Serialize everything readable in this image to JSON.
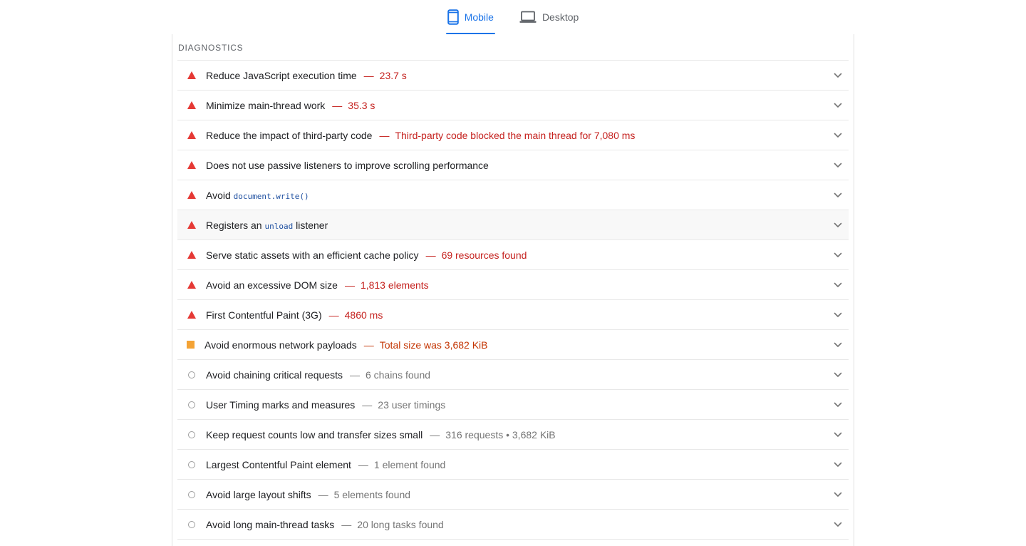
{
  "tabs": [
    {
      "label": "Mobile",
      "active": true,
      "icon": "phone-icon"
    },
    {
      "label": "Desktop",
      "active": false,
      "icon": "laptop-icon"
    }
  ],
  "colors": {
    "accent": "#1a73e8",
    "fail": "#e53935",
    "fail_text": "#c5221f",
    "average": "#f4a335",
    "average_text": "#c33300",
    "info_text": "#757575"
  },
  "diagnostics": {
    "title": "DIAGNOSTICS",
    "audits": [
      {
        "status": "fail",
        "title": "Reduce JavaScript execution time",
        "display": "23.7 s"
      },
      {
        "status": "fail",
        "title": "Minimize main-thread work",
        "display": "35.3 s"
      },
      {
        "status": "fail",
        "title": "Reduce the impact of third-party code",
        "display": "Third-party code blocked the main thread for 7,080 ms"
      },
      {
        "status": "fail",
        "title": "Does not use passive listeners to improve scrolling performance",
        "display": ""
      },
      {
        "status": "fail",
        "title_prefix": "Avoid ",
        "code": "document.write()",
        "title_suffix": "",
        "display": ""
      },
      {
        "status": "fail",
        "title_prefix": "Registers an ",
        "code": "unload",
        "title_suffix": " listener",
        "display": "",
        "hover": true
      },
      {
        "status": "fail",
        "title": "Serve static assets with an efficient cache policy",
        "display": "69 resources found"
      },
      {
        "status": "fail",
        "title": "Avoid an excessive DOM size",
        "display": "1,813 elements"
      },
      {
        "status": "fail",
        "title": "First Contentful Paint (3G)",
        "display": "4860 ms"
      },
      {
        "status": "average",
        "title": "Avoid enormous network payloads",
        "display": "Total size was 3,682 KiB"
      },
      {
        "status": "info",
        "title": "Avoid chaining critical requests",
        "display": "6 chains found"
      },
      {
        "status": "info",
        "title": "User Timing marks and measures",
        "display": "23 user timings"
      },
      {
        "status": "info",
        "title": "Keep request counts low and transfer sizes small",
        "display": "316 requests • 3,682 KiB"
      },
      {
        "status": "info",
        "title": "Largest Contentful Paint element",
        "display": "1 element found"
      },
      {
        "status": "info",
        "title": "Avoid large layout shifts",
        "display": "5 elements found"
      },
      {
        "status": "info",
        "title": "Avoid long main-thread tasks",
        "display": "20 long tasks found"
      }
    ]
  }
}
